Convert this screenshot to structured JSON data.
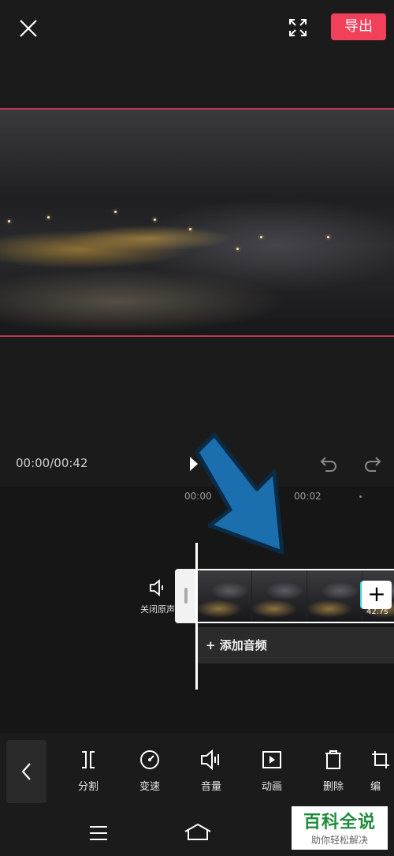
{
  "header": {
    "export_label": "导出"
  },
  "timeline": {
    "time_readout": "00:00/00:42",
    "ruler_ticks": [
      "00:00",
      "00:02"
    ],
    "mute_label": "关闭原声",
    "clip_duration": "42.7s",
    "add_clip_symbol": "+",
    "add_audio_label": "+ 添加音频"
  },
  "toolbar": {
    "items": [
      {
        "label": "分割",
        "icon": "split-icon"
      },
      {
        "label": "变速",
        "icon": "speed-icon"
      },
      {
        "label": "音量",
        "icon": "volume-icon"
      },
      {
        "label": "动画",
        "icon": "animation-icon"
      },
      {
        "label": "删除",
        "icon": "delete-icon"
      },
      {
        "label": "编",
        "icon": "crop-icon"
      }
    ]
  },
  "watermark": {
    "title": "百科全说",
    "subtitle": "助你轻松解决"
  },
  "colors": {
    "accent": "#f0405a",
    "arrow": "#1c6fae",
    "background": "#1b1b1b"
  }
}
